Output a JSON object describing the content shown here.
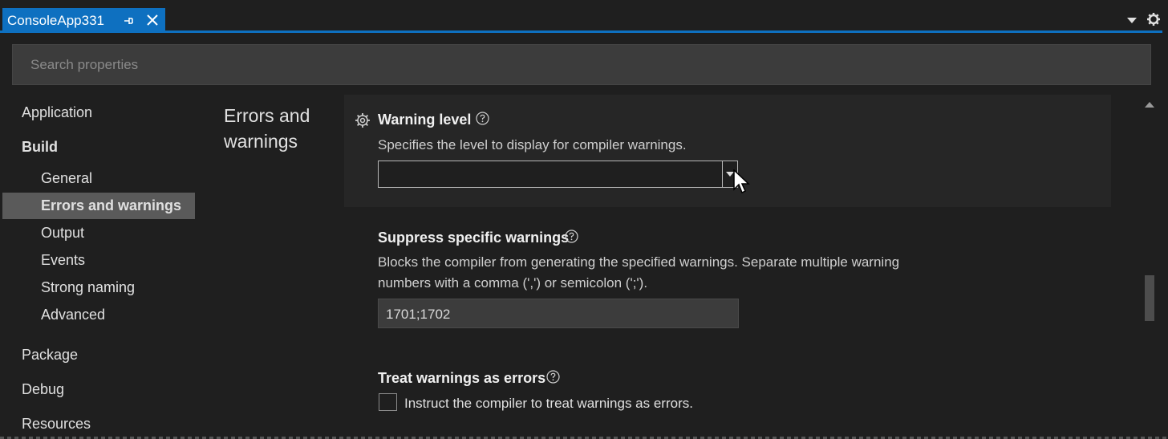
{
  "tab": {
    "title": "ConsoleApp331"
  },
  "search": {
    "placeholder": "Search properties"
  },
  "nav": {
    "application": "Application",
    "build": "Build",
    "build_items": [
      "General",
      "Errors and warnings",
      "Output",
      "Events",
      "Strong naming",
      "Advanced"
    ],
    "package": "Package",
    "debug": "Debug",
    "resources": "Resources",
    "selected": "Errors and warnings"
  },
  "section": {
    "title": "Errors and warnings"
  },
  "properties": {
    "warning_level": {
      "title": "Warning level",
      "description": "Specifies the level to display for compiler warnings.",
      "value": ""
    },
    "suppress": {
      "title": "Suppress specific warnings",
      "description_line1": "Blocks the compiler from generating the specified warnings. Separate multiple warning",
      "description_line2": "numbers with a comma (',') or semicolon (';').",
      "value": "1701;1702"
    },
    "treat_as_errors": {
      "title": "Treat warnings as errors",
      "checkbox_label": "Instruct the compiler to treat warnings as errors.",
      "checked": false
    }
  },
  "icons": {
    "pin": "pin-icon",
    "close": "close-icon",
    "settings": "gear-icon",
    "help": "help-icon",
    "dropdown": "chevron-down-icon"
  },
  "colors": {
    "accent": "#0e70c0",
    "background": "#1f1f1f",
    "selected": "#5a5a5a"
  }
}
